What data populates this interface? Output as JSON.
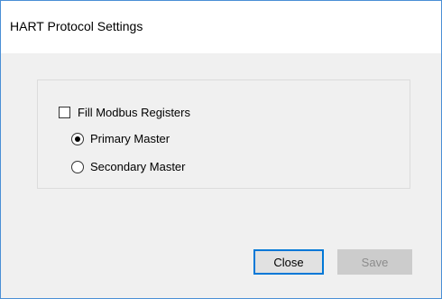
{
  "window": {
    "title": "HART Protocol Settings"
  },
  "options": {
    "fill_modbus_label": "Fill Modbus Registers",
    "fill_modbus_checked": false,
    "primary_master_label": "Primary Master",
    "secondary_master_label": "Secondary Master",
    "selected": "Primary Master"
  },
  "buttons": {
    "close_label": "Close",
    "save_label": "Save",
    "save_enabled": false
  },
  "colors": {
    "accent": "#0078d7",
    "window_border": "#4a8fd6",
    "dialog_background": "#f0f0f0",
    "disabled_button": "#cccccc"
  }
}
